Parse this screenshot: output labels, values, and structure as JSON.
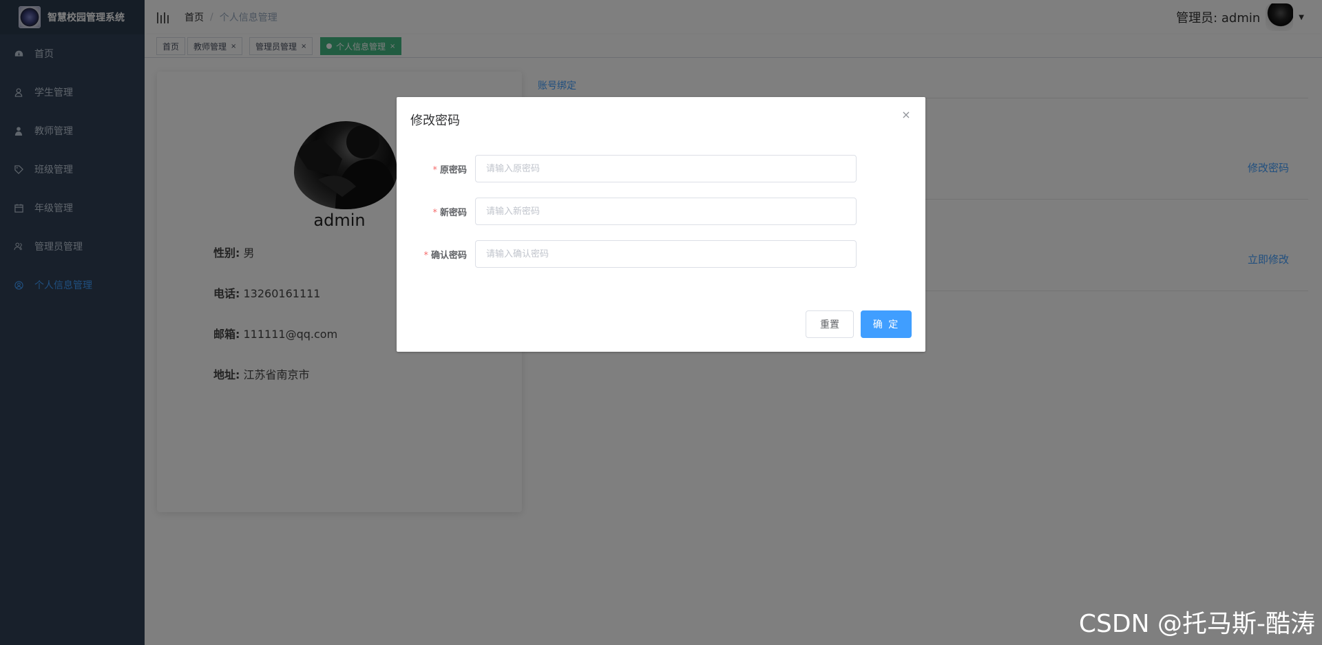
{
  "app": {
    "title": "智慧校园管理系统"
  },
  "sidebar": {
    "items": [
      {
        "label": "首页",
        "icon": "dashboard-icon"
      },
      {
        "label": "学生管理",
        "icon": "user-icon"
      },
      {
        "label": "教师管理",
        "icon": "teacher-icon"
      },
      {
        "label": "班级管理",
        "icon": "tag-icon"
      },
      {
        "label": "年级管理",
        "icon": "calendar-icon"
      },
      {
        "label": "管理员管理",
        "icon": "group-icon"
      },
      {
        "label": "个人信息管理",
        "icon": "profile-icon",
        "active": true
      }
    ]
  },
  "header": {
    "breadcrumb_home": "首页",
    "breadcrumb_sep": "/",
    "breadcrumb_current": "个人信息管理",
    "user_label": "管理员: admin"
  },
  "tags": [
    {
      "label": "首页",
      "closable": false
    },
    {
      "label": "教师管理",
      "closable": true
    },
    {
      "label": "管理员管理",
      "closable": true
    },
    {
      "label": "个人信息管理",
      "closable": true,
      "active": true
    }
  ],
  "profile": {
    "name": "admin",
    "gender_label": "性别:",
    "gender": "男",
    "phone_label": "电话:",
    "phone": "13260161111",
    "email_label": "邮箱:",
    "email": "111111@qq.com",
    "address_label": "地址:",
    "address": "江苏省南京市"
  },
  "account": {
    "tab_label": "账号绑定",
    "change_password_link": "修改密码",
    "modify_now_link": "立即修改"
  },
  "dialog": {
    "title": "修改密码",
    "close_symbol": "×",
    "required_mark": "*",
    "fields": [
      {
        "label": "原密码",
        "placeholder": "请输入原密码",
        "value": ""
      },
      {
        "label": "新密码",
        "placeholder": "请输入新密码",
        "value": ""
      },
      {
        "label": "确认密码",
        "placeholder": "请输入确认密码",
        "value": ""
      }
    ],
    "reset_label": "重置",
    "confirm_label": "确 定"
  },
  "watermark": {
    "text": "CSDN @托马斯-酷涛"
  },
  "colors": {
    "sidebar_bg": "#304156",
    "accent": "#409eff",
    "tag_active": "#42b983",
    "required": "#f56c6c"
  }
}
